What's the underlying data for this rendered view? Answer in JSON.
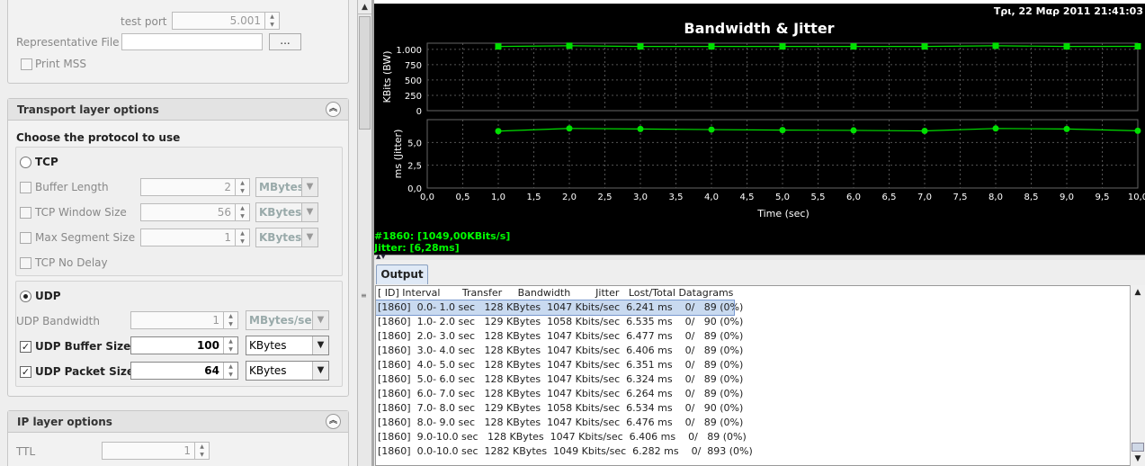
{
  "left": {
    "test_port_label": "test port",
    "test_port_value": "5.001",
    "rep_file_label": "Representative File",
    "rep_file_btn": "...",
    "print_mss": "Print MSS",
    "transport": {
      "title": "Transport layer options",
      "choose": "Choose the protocol to use",
      "tcp": "TCP",
      "buffer_length": "Buffer Length",
      "buffer_length_val": "2",
      "buffer_length_unit": "MBytes",
      "tcp_window": "TCP Window Size",
      "tcp_window_val": "56",
      "tcp_window_unit": "KBytes",
      "max_seg": "Max Segment Size",
      "max_seg_val": "1",
      "max_seg_unit": "KBytes",
      "no_delay": "TCP No Delay",
      "udp": "UDP",
      "udp_bw": "UDP Bandwidth",
      "udp_bw_val": "1",
      "udp_bw_unit": "MBytes/sec",
      "udp_buf": "UDP Buffer Size",
      "udp_buf_val": "100",
      "udp_buf_unit": "KBytes",
      "udp_pkt": "UDP Packet Size",
      "udp_pkt_val": "64",
      "udp_pkt_unit": "KBytes"
    },
    "ip": {
      "title": "IP layer options",
      "ttl": "TTL",
      "ttl_val": "1"
    }
  },
  "chart_data": {
    "type": "line",
    "title": "Bandwidth & Jitter",
    "datetime": "Τρι, 22 Μαρ 2011 21:41:03",
    "xlabel": "Time (sec)",
    "xlim": [
      0,
      10
    ],
    "xticks": [
      "0,0",
      "0,5",
      "1,0",
      "1,5",
      "2,0",
      "2,5",
      "3,0",
      "3,5",
      "4,0",
      "4,5",
      "5,0",
      "5,5",
      "6,0",
      "6,5",
      "7,0",
      "7,5",
      "8,0",
      "8,5",
      "9,0",
      "9,5",
      "10,0"
    ],
    "series": [
      {
        "ylabel": "KBits (BW)",
        "yticks": [
          "1.000",
          "750",
          "500",
          "250",
          "0"
        ],
        "ylim": [
          0,
          1100
        ],
        "x": [
          1,
          2,
          3,
          4,
          5,
          6,
          7,
          8,
          9,
          10
        ],
        "values": [
          1047,
          1058,
          1047,
          1047,
          1047,
          1047,
          1047,
          1058,
          1047,
          1049
        ],
        "color": "#00e000"
      },
      {
        "ylabel": "ms (Jitter)",
        "yticks": [
          "5,0",
          "2,5",
          "0,0"
        ],
        "ylim": [
          0,
          7.5
        ],
        "x": [
          1,
          2,
          3,
          4,
          5,
          6,
          7,
          8,
          9,
          10
        ],
        "values": [
          6.241,
          6.535,
          6.477,
          6.406,
          6.351,
          6.324,
          6.264,
          6.534,
          6.476,
          6.282
        ],
        "color": "#00e000"
      }
    ],
    "status1": "#1860: [1049,00KBits/s]",
    "status2": "Jitter: [6,28ms]"
  },
  "output": {
    "tab": "Output",
    "lines": [
      "[ ID] Interval       Transfer     Bandwidth        Jitter   Lost/Total Datagrams",
      "[1860]  0.0- 1.0 sec   128 KBytes  1047 Kbits/sec  6.241 ms    0/   89 (0%)",
      "[1860]  1.0- 2.0 sec   129 KBytes  1058 Kbits/sec  6.535 ms    0/   90 (0%)",
      "[1860]  2.0- 3.0 sec   128 KBytes  1047 Kbits/sec  6.477 ms    0/   89 (0%)",
      "[1860]  3.0- 4.0 sec   128 KBytes  1047 Kbits/sec  6.406 ms    0/   89 (0%)",
      "[1860]  4.0- 5.0 sec   128 KBytes  1047 Kbits/sec  6.351 ms    0/   89 (0%)",
      "[1860]  5.0- 6.0 sec   128 KBytes  1047 Kbits/sec  6.324 ms    0/   89 (0%)",
      "[1860]  6.0- 7.0 sec   128 KBytes  1047 Kbits/sec  6.264 ms    0/   89 (0%)",
      "[1860]  7.0- 8.0 sec   129 KBytes  1058 Kbits/sec  6.534 ms    0/   90 (0%)",
      "[1860]  8.0- 9.0 sec   128 KBytes  1047 Kbits/sec  6.476 ms    0/   89 (0%)",
      "[1860]  9.0-10.0 sec   128 KBytes  1047 Kbits/sec  6.406 ms    0/   89 (0%)",
      "[1860]  0.0-10.0 sec  1282 KBytes  1049 Kbits/sec  6.282 ms    0/  893 (0%)"
    ]
  }
}
